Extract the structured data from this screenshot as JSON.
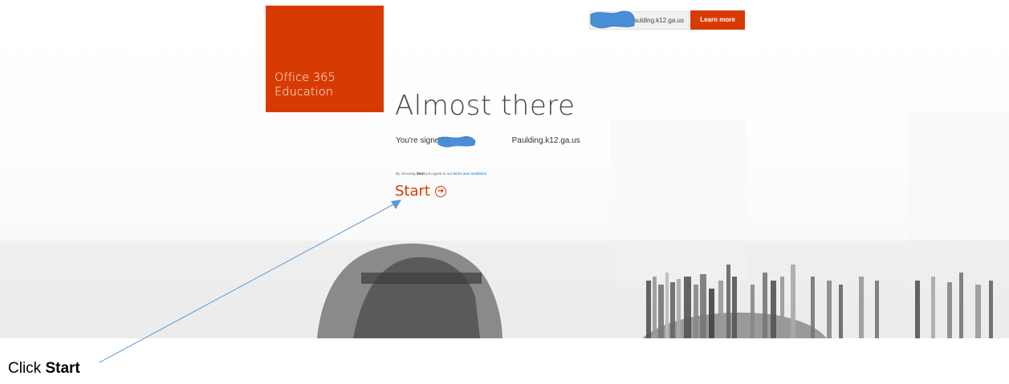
{
  "tile": {
    "line1": "Office 365",
    "line2": "Education"
  },
  "account": {
    "suffix": "aulding.k12.ga.us"
  },
  "learn_more": "Learn more",
  "heading": "Almost there",
  "signed_in": {
    "prefix": "You're signed in as",
    "suffix": "Paulding.k12.ga.us"
  },
  "terms": {
    "prefix": "By choosing",
    "bold": "Start",
    "middle": "you agree to our",
    "link": "terms and conditions"
  },
  "start_label": "Start",
  "caption": {
    "prefix": "Click",
    "bold": "Start"
  },
  "colors": {
    "accent": "#d83b01",
    "redaction": "#4a8fd6",
    "annotation": "#5b9bd5"
  },
  "icons": {
    "start_arrow": "circle-arrow-right-icon"
  }
}
